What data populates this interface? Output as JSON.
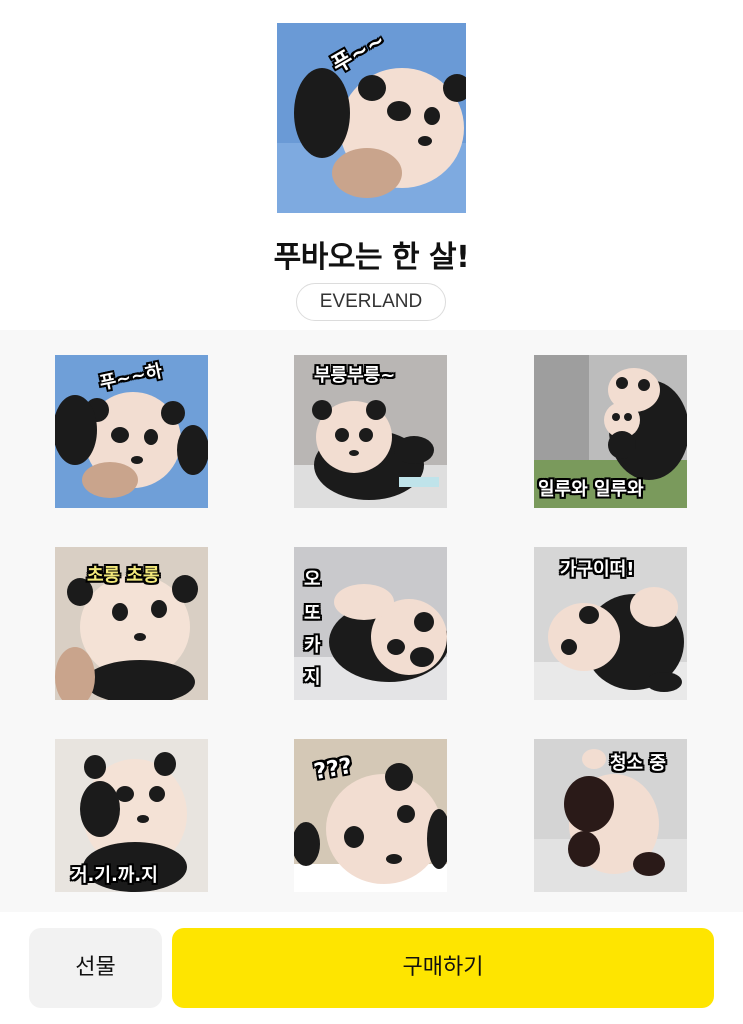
{
  "header": {
    "cover_caption": "푸~~",
    "title": "푸바오는 한 살!",
    "brand": "EVERLAND"
  },
  "stickers": [
    {
      "caption": "푸~~하",
      "bg": "#6f9fd8"
    },
    {
      "caption": "부릉부릉~",
      "bg": "#b9b6b4"
    },
    {
      "caption": "일루와 일루와",
      "bg": "#bcbcbc"
    },
    {
      "caption": "초롱 초롱",
      "bg": "#d9cfc4"
    },
    {
      "caption_lines": [
        "오",
        "또",
        "카",
        "지"
      ],
      "bg": "#c9c9cc"
    },
    {
      "caption": "가구이떠!",
      "bg": "#d6d6d6"
    },
    {
      "caption": "거.기.까.지",
      "bg": "#e8e4df"
    },
    {
      "caption": "???",
      "bg": "#d4c8b6"
    },
    {
      "caption": "청소 중",
      "bg": "#d4d4d4"
    }
  ],
  "footer": {
    "gift_label": "선물",
    "buy_label": "구매하기"
  },
  "colors": {
    "accent": "#fee500",
    "grid_bg": "#f8f8f8"
  }
}
